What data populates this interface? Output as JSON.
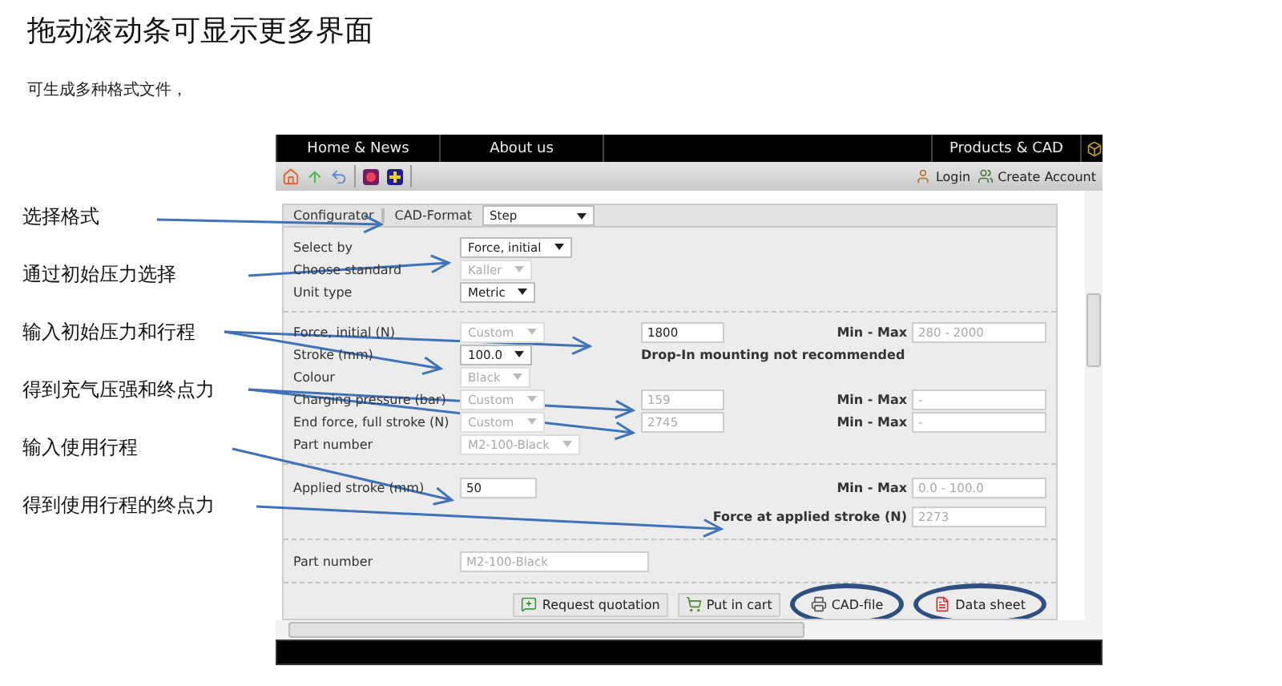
{
  "heading": "拖动滚动条可显示更多界面",
  "intro": "可生成多种格式文件，",
  "annotations": [
    {
      "label": "选择格式"
    },
    {
      "label": "通过初始压力选择"
    },
    {
      "label": "输入初始压力和行程"
    },
    {
      "label": "得到充气压强和终点力"
    },
    {
      "label": "输入使用行程"
    },
    {
      "label": "得到使用行程的终点力"
    }
  ],
  "app": {
    "nav_left": [
      "Home & News",
      "About us"
    ],
    "nav_right": [
      "Products & CAD"
    ],
    "account_links": [
      "Login",
      "Create Account"
    ],
    "configurator": {
      "tab": "Configurator",
      "format_label": "CAD-Format",
      "format": "Step"
    },
    "sections": [
      [
        {
          "label": "Select by",
          "select": {
            "value": "Force, initial",
            "disabled": false
          }
        },
        {
          "label": "Choose standard",
          "select": {
            "value": "Kaller",
            "disabled": true
          }
        },
        {
          "label": "Unit type",
          "select": {
            "value": "Metric",
            "disabled": false
          }
        }
      ],
      [
        {
          "label": "Force, initial (N)",
          "select": {
            "value": "Custom",
            "disabled": true
          },
          "input": {
            "value": "1800",
            "disabled": false
          },
          "range": {
            "label": "Min - Max",
            "value": "280 - 2000"
          }
        },
        {
          "label": "Stroke (mm)",
          "select": {
            "value": "100.0",
            "disabled": false
          },
          "note": "Drop-In mounting not recommended"
        },
        {
          "label": "Colour",
          "select": {
            "value": "Black",
            "disabled": true
          }
        },
        {
          "label": "Charging pressure (bar)",
          "select": {
            "value": "Custom",
            "disabled": true
          },
          "input": {
            "value": "159",
            "disabled": true
          },
          "range": {
            "label": "Min - Max",
            "value": "-"
          }
        },
        {
          "label": "End force, full stroke (N)",
          "select": {
            "value": "Custom",
            "disabled": true
          },
          "input": {
            "value": "2745",
            "disabled": true
          },
          "range": {
            "label": "Min - Max",
            "value": "-"
          }
        },
        {
          "label": "Part number",
          "select": {
            "value": "M2-100-Black",
            "disabled": true
          }
        }
      ],
      [
        {
          "label": "Applied stroke (mm)",
          "input": {
            "value": "50",
            "disabled": false
          },
          "range": {
            "label": "Min - Max",
            "value": "0.0 - 100.0"
          }
        },
        {
          "range": {
            "label": "Force at applied stroke (N)",
            "value": "2273"
          }
        }
      ]
    ],
    "part_number": {
      "label": "Part number",
      "value": "M2-100-Black",
      "disabled": true
    },
    "buttons": [
      {
        "label": "Request quotation",
        "kind": "quote",
        "circled": false
      },
      {
        "label": "Put in cart",
        "kind": "cart",
        "circled": false
      },
      {
        "label": "CAD-file",
        "kind": "cad",
        "circled": true
      },
      {
        "label": "Data sheet",
        "kind": "pdf",
        "circled": true
      }
    ]
  }
}
